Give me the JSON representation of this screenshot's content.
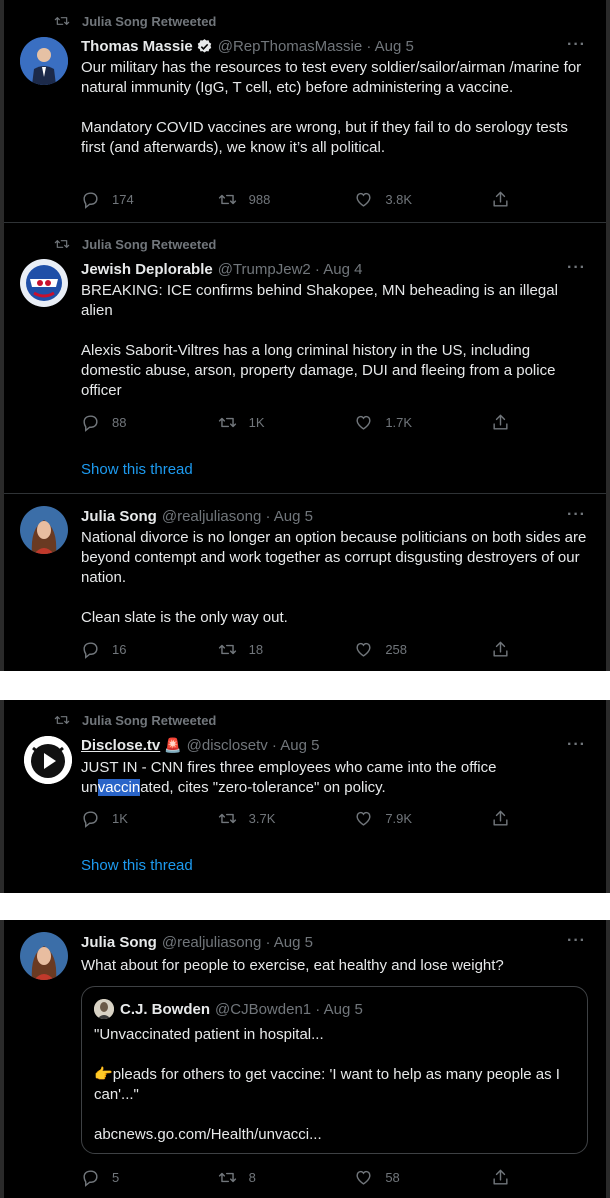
{
  "colors": {
    "background": "#000000",
    "text": "#e7e9ea",
    "muted": "#71767b",
    "link": "#1d9bf0",
    "divider": "#2f3336"
  },
  "tweets": [
    {
      "retweeted_by": "Julia Song Retweeted",
      "name": "Thomas Massie",
      "handle": "@RepThomasMassie · Aug 5",
      "paragraphs": [
        "Our military has the resources to test every soldier/sailor/airman /marine for natural immunity (IgG, T cell, etc) before administering a vaccine.",
        "Mandatory COVID vaccines are wrong, but if they fail to do serology tests first (and afterwards), we know it’s all political."
      ],
      "replies": "174",
      "retweets": "988",
      "likes": "3.8K"
    },
    {
      "retweeted_by": "Julia Song Retweeted",
      "name": "Jewish Deplorable",
      "handle": "@TrumpJew2 · Aug 4",
      "paragraphs": [
        "BREAKING: ICE confirms behind Shakopee, MN beheading is an illegal alien",
        "Alexis Saborit-Viltres has a long criminal history in the US, including domestic abuse, arson, property damage, DUI and fleeing from a police officer"
      ],
      "replies": "88",
      "retweets": "1K",
      "likes": "1.7K",
      "show_thread": "Show this thread"
    },
    {
      "name": "Julia Song",
      "handle": "@realjuliasong · Aug 5",
      "paragraphs": [
        "National divorce is no longer an option because politicians on both sides are beyond contempt and work together as corrupt disgusting destroyers of our nation.",
        "Clean slate is the only way out."
      ],
      "replies": "16",
      "retweets": "18",
      "likes": "258"
    },
    {
      "retweeted_by": "Julia Song Retweeted",
      "name": "Disclose.tv",
      "badge": "🚨",
      "handle": "@disclosetv · Aug 5",
      "line1": "JUST IN - CNN fires three employees who came into the office",
      "line2_pre": "un",
      "line2_hl": "vaccin",
      "line2_post": "ated, cites \"zero-tolerance\" on policy.",
      "replies": "1K",
      "retweets": "3.7K",
      "likes": "7.9K",
      "show_thread": "Show this thread"
    },
    {
      "name": "Julia Song",
      "handle": "@realjuliasong · Aug 5",
      "paragraphs": [
        "What about for people to exercise, eat healthy and lose weight?"
      ],
      "quote": {
        "name": "C.J. Bowden",
        "handle": "@CJBowden1 · Aug 5",
        "line1": "\"Unvaccinated patient in hospital...",
        "emoji": "👉",
        "line2": "pleads for others to get vaccine: 'I want to help as many people as I can'...\"",
        "link": "abcnews.go.com/Health/unvacci..."
      },
      "replies": "5",
      "retweets": "8",
      "likes": "58"
    }
  ],
  "more_glyph": "···",
  "icons": {
    "retweeted": "retweet-icon",
    "reply": "reply-icon",
    "retweet": "retweet-icon",
    "like": "heart-icon",
    "share": "share-icon",
    "verified": "verified-badge-icon"
  }
}
